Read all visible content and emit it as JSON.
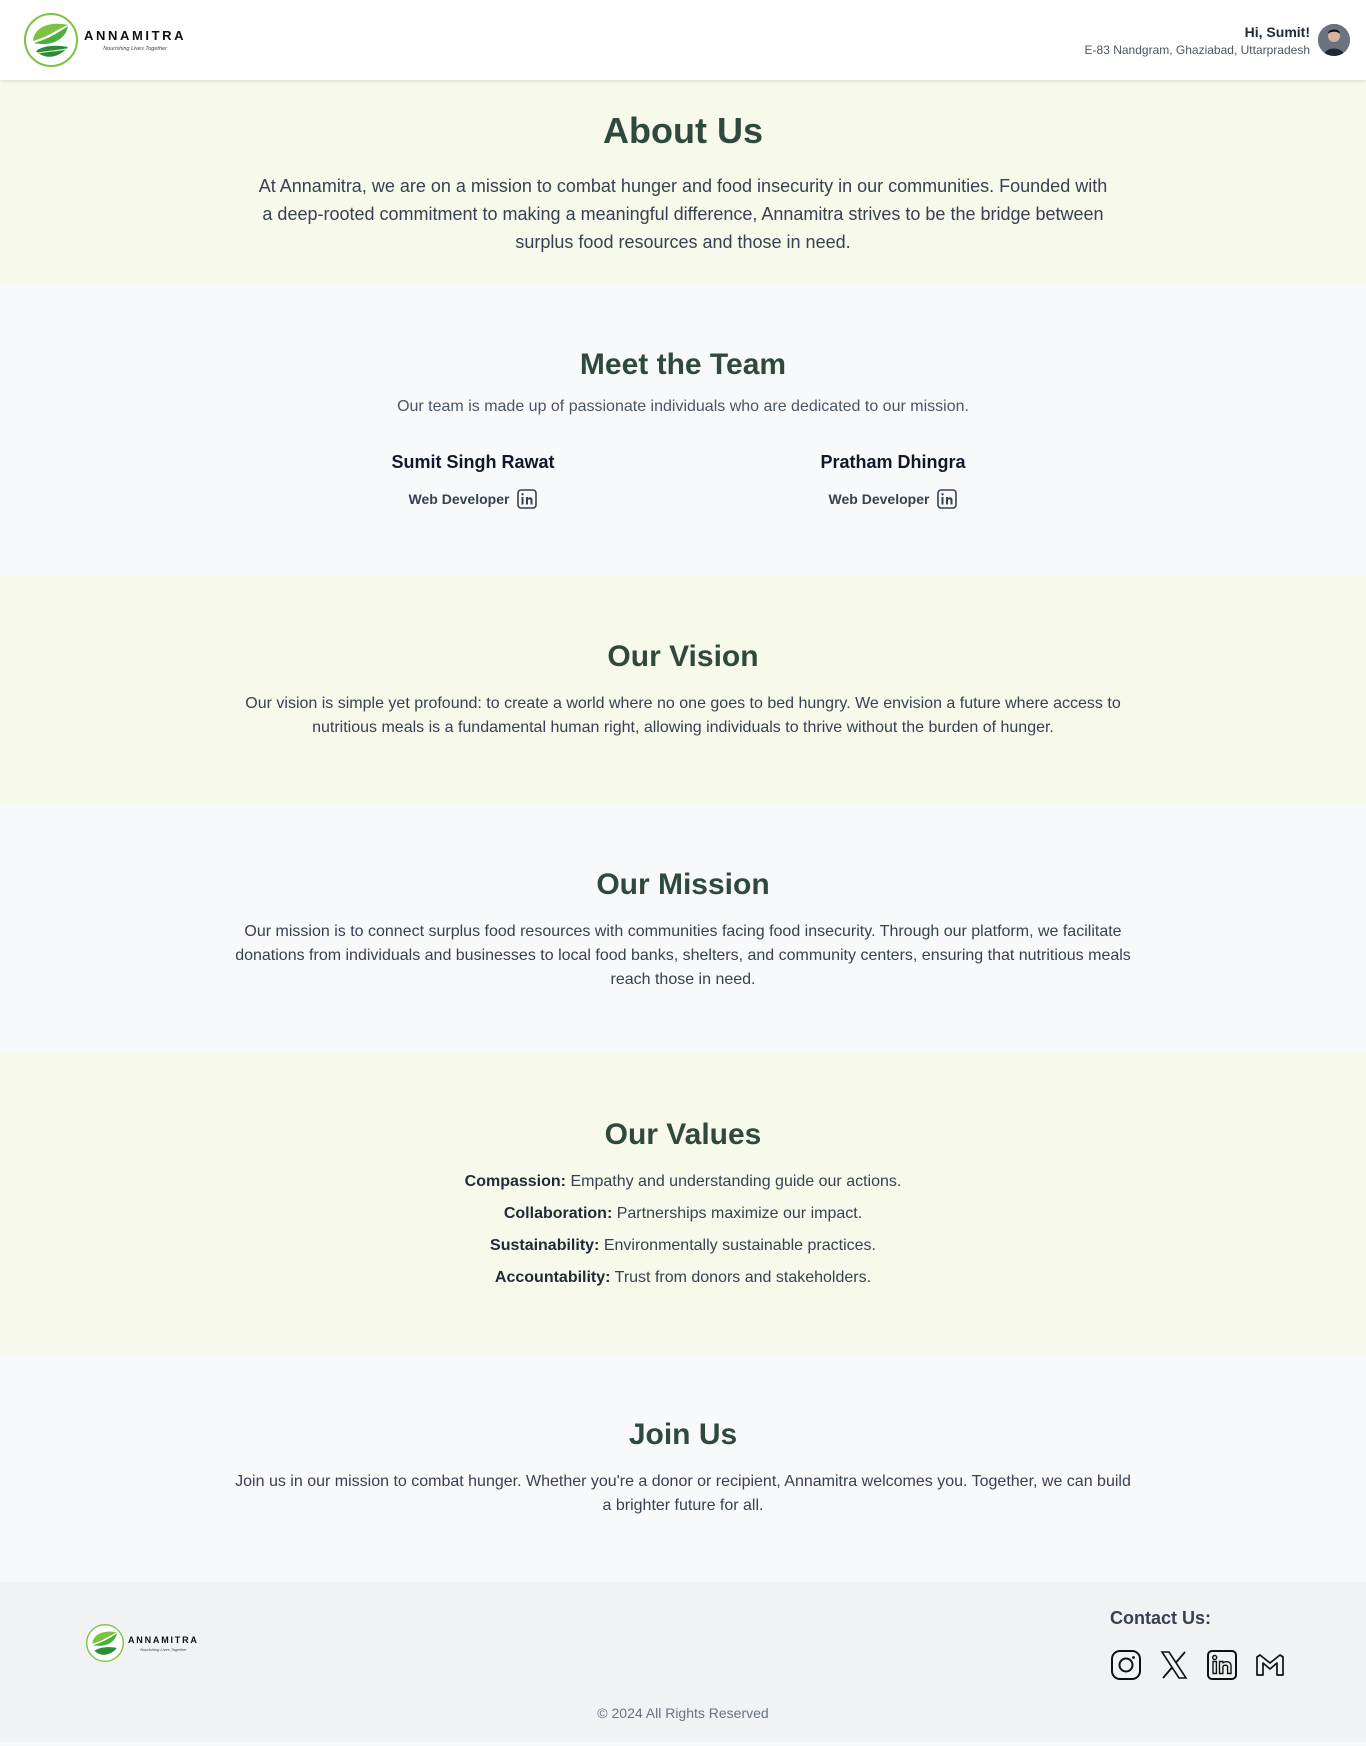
{
  "header": {
    "brand_name": "ANNAMITRA",
    "brand_tagline": "Nourishing Lives Together",
    "greeting": "Hi, Sumit!",
    "address": "E-83 Nandgram, Ghaziabad, Uttarpradesh"
  },
  "about": {
    "title": "About Us",
    "text": "At Annamitra, we are on a mission to combat hunger and food insecurity in our communities. Founded with a deep-rooted commitment to making a meaningful difference, Annamitra strives to be the bridge between surplus food resources and those in need."
  },
  "team": {
    "title": "Meet the Team",
    "subtitle": "Our team is made up of passionate individuals who are dedicated to our mission.",
    "members": [
      {
        "name": "Sumit Singh Rawat",
        "role": "Web Developer"
      },
      {
        "name": "Pratham Dhingra",
        "role": "Web Developer"
      }
    ]
  },
  "vision": {
    "title": "Our Vision",
    "text": "Our vision is simple yet profound: to create a world where no one goes to bed hungry. We envision a future where access to nutritious meals is a fundamental human right, allowing individuals to thrive without the burden of hunger."
  },
  "mission": {
    "title": "Our Mission",
    "text": "Our mission is to connect surplus food resources with communities facing food insecurity. Through our platform, we facilitate donations from individuals and businesses to local food banks, shelters, and community centers, ensuring that nutritious meals reach those in need."
  },
  "values": {
    "title": "Our Values",
    "items": [
      {
        "label": "Compassion:",
        "text": "Empathy and understanding guide our actions."
      },
      {
        "label": "Collaboration:",
        "text": "Partnerships maximize our impact."
      },
      {
        "label": "Sustainability:",
        "text": "Environmentally sustainable practices."
      },
      {
        "label": "Accountability:",
        "text": "Trust from donors and stakeholders."
      }
    ]
  },
  "join": {
    "title": "Join Us",
    "text": "Join us in our mission to combat hunger. Whether you're a donor or recipient, Annamitra welcomes you. Together, we can build a brighter future for all."
  },
  "footer": {
    "brand_name": "ANNAMITRA",
    "brand_tagline": "Nourishing Lives Together",
    "contact_title": "Contact Us:",
    "socials": [
      "instagram-icon",
      "x-icon",
      "linkedin-icon",
      "gmail-icon"
    ],
    "copyright": "© 2024 All Rights Reserved"
  },
  "colors": {
    "heading": "#2f4a3c",
    "section_tint": "#f7f9ea",
    "section_plain": "#f8f9fb",
    "footer_bg": "#f0f2f4",
    "leaf_green": "#7cc243",
    "leaf_dark": "#2e8b3a"
  }
}
